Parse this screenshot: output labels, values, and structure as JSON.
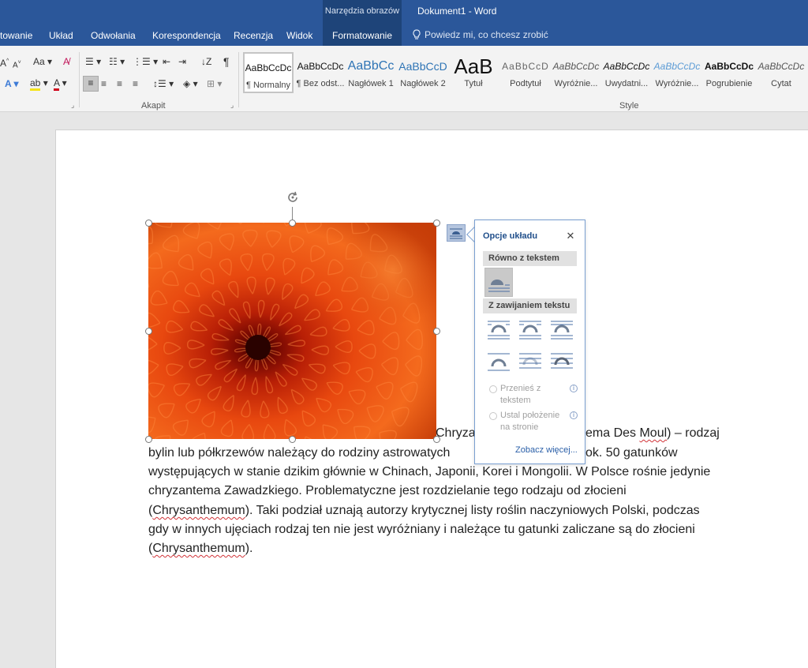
{
  "titlebar": {
    "context_group": "Narzędzia obrazów",
    "doc_title": "Dokument1 - Word",
    "tabs": [
      "towanie",
      "Układ",
      "Odwołania",
      "Korespondencja",
      "Recenzja",
      "Widok",
      "Formatowanie"
    ],
    "active_tab": "Formatowanie",
    "tell_me": "Powiedz mi, co chcesz zrobić"
  },
  "ribbon": {
    "font_row1": [
      "A",
      "A",
      "Aa",
      "✎"
    ],
    "paragraph_group_label": "Akapit",
    "styles_group_label": "Style",
    "styles": [
      {
        "preview": "AaBbCcDc",
        "name": "¶ Normalny"
      },
      {
        "preview": "AaBbCcDc",
        "name": "¶ Bez odst..."
      },
      {
        "preview": "AaBbCc",
        "name": "Nagłówek 1"
      },
      {
        "preview": "AaBbCcD",
        "name": "Nagłówek 2"
      },
      {
        "preview": "AaB",
        "name": "Tytuł"
      },
      {
        "preview": "AaBbCcD",
        "name": "Podtytuł"
      },
      {
        "preview": "AaBbCcDc",
        "name": "Wyróżnie..."
      },
      {
        "preview": "AaBbCcDc",
        "name": "Uwydatni..."
      },
      {
        "preview": "AaBbCcDc",
        "name": "Wyróżnie..."
      },
      {
        "preview": "AaBbCcDc",
        "name": "Pogrubienie"
      },
      {
        "preview": "AaBbCcDc",
        "name": "Cytat"
      }
    ]
  },
  "document": {
    "first_line_visible": "Chryza",
    "first_line_mid": "ema Des ",
    "first_line_spell": "Moul",
    "first_line_end": ") – rodzaj",
    "line2_start": "bylin lub półkrzewów należący do rodziny astrowatych",
    "line2_end": "ok. 50 gatunków",
    "line3": "występujących w stanie dzikim głównie w Chinach, Japonii, Korei i Mongolii. W Polsce rośnie jedynie",
    "line4": "chryzantema Zawadzkiego. Problematyczne jest rozdzielanie tego rodzaju od złocieni",
    "line5_a": "(",
    "line5_spell": "Chrysanthemum",
    "line5_b": "). Taki podział uznają autorzy krytycznej listy roślin naczyniowych Polski, podczas",
    "line6": "gdy w innych ujęciach rodzaj ten nie jest wyróżniany i należące tu gatunki zaliczane są do złocieni",
    "line7_a": "(",
    "line7_spell": "Chrysanthemum",
    "line7_b": ")."
  },
  "layout_options": {
    "title": "Opcje układu",
    "section_inline": "Równo z tekstem",
    "section_wrap": "Z zawijaniem tekstu",
    "radio1_line1": "Przenieś z",
    "radio1_line2": "tekstem",
    "radio2_line1": "Ustal położenie",
    "radio2_line2": "na stronie",
    "see_more": "Zobacz więcej..."
  }
}
